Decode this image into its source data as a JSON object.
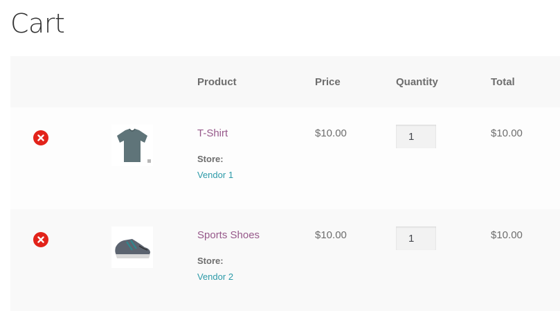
{
  "page": {
    "title": "Cart"
  },
  "table": {
    "headers": {
      "product": "Product",
      "price": "Price",
      "quantity": "Quantity",
      "total": "Total"
    },
    "rows": [
      {
        "product_name": "T-Shirt",
        "image_icon": "tshirt-thumbnail",
        "store_label": "Store:",
        "vendor": "Vendor 1",
        "price": "$10.00",
        "quantity": "1",
        "total": "$10.00"
      },
      {
        "product_name": "Sports Shoes",
        "image_icon": "shoe-thumbnail",
        "store_label": "Store:",
        "vendor": "Vendor 2",
        "price": "$10.00",
        "quantity": "1",
        "total": "$10.00"
      }
    ]
  },
  "colors": {
    "accent_product": "#96588a",
    "vendor_link": "#2c9aa8",
    "remove": "#e2231a"
  }
}
